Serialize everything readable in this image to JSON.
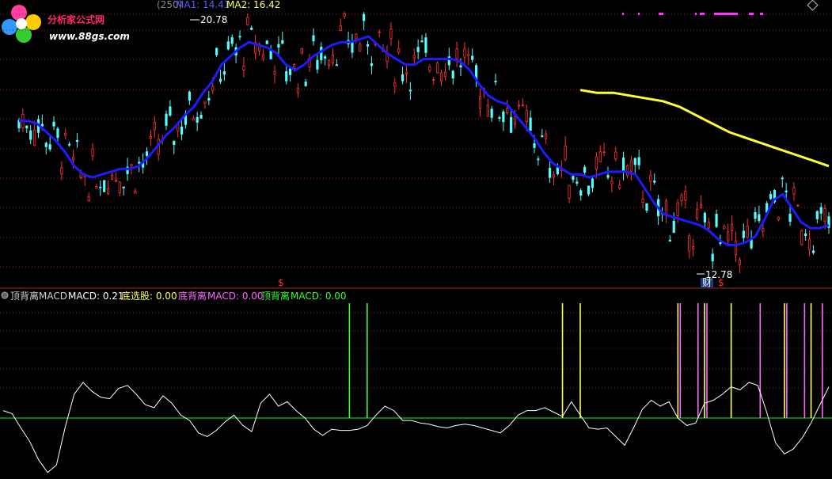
{
  "header": {
    "title_obscured": "(250)",
    "ma1_label": "MA1: 14.41",
    "ma2_label": "MA2: 16.42"
  },
  "watermark": {
    "name": "分析家公式网",
    "url": "www.88gs.com"
  },
  "indicator_header": {
    "title": "顶背离MACD",
    "macd": "MACD: 0.21",
    "bottom_pick": "底选股: 0.00",
    "bottom_div_a": "底背离",
    "bottom_div_b": "MACD: 0.00",
    "top_div_a": "顶背离",
    "top_div_b": "MACD: 0.00"
  },
  "annotations": {
    "high_label": "20.78",
    "low_label": "12.78",
    "marker_s": "$",
    "marker_cai": "财"
  },
  "colors": {
    "background": "#000000",
    "up_candle": "#ff3232",
    "down_candle": "#54ffff",
    "ma1": "#1c1cff",
    "ma2": "#ffff33",
    "macd_line": "#ffffff",
    "zero_line": "#00cc00",
    "top_div_bar": "#33ff33",
    "bottom_pick_bar": "#ffff66",
    "bottom_div_bar": "#ff66ff",
    "grid": "#8a1a1a",
    "separator": "#b02020"
  },
  "chart_data": [
    {
      "type": "candlestick",
      "ylim": [
        12.2,
        21.5
      ],
      "series": [
        {
          "name": "MA1",
          "values": [
            17.6,
            17.6,
            17.5,
            17.2,
            16.9,
            16.5,
            16.0,
            15.7,
            15.6,
            15.7,
            15.8,
            15.9,
            15.9,
            16.0,
            16.3,
            16.7,
            17.1,
            17.4,
            17.8,
            18.1,
            18.6,
            19.0,
            19.6,
            19.9,
            20.2,
            20.4,
            20.3,
            20.2,
            20.0,
            19.6,
            19.4,
            19.6,
            19.9,
            20.1,
            20.3,
            20.4,
            20.4,
            20.5,
            20.6,
            20.3,
            20.0,
            19.8,
            19.6,
            19.6,
            19.8,
            19.8,
            19.8,
            19.8,
            19.7,
            19.4,
            18.9,
            18.5,
            18.3,
            18.2,
            17.8,
            17.4,
            17.0,
            16.5,
            16.1,
            15.9,
            15.7,
            15.7,
            15.6,
            15.7,
            15.8,
            15.8,
            15.8,
            15.7,
            15.2,
            14.7,
            14.3,
            14.2,
            14.1,
            14.0,
            13.9,
            13.7,
            13.4,
            13.2,
            13.2,
            13.3,
            13.5,
            14.1,
            14.8,
            15.0,
            14.5,
            14.0,
            13.8,
            13.8,
            13.9
          ]
        },
        {
          "name": "MA2",
          "values": [
            18.7,
            18.6,
            18.6,
            18.5,
            18.4,
            18.3,
            18.1,
            17.8,
            17.5,
            17.2,
            17.0,
            16.8,
            16.6,
            16.4,
            16.2,
            16.0
          ]
        }
      ],
      "ma2_start_index": 61,
      "high": 20.78,
      "low": 12.78
    },
    {
      "type": "line",
      "series": [
        {
          "name": "MACD",
          "values": [
            0.05,
            0.03,
            -0.08,
            -0.19,
            -0.34,
            -0.44,
            -0.38,
            -0.07,
            0.16,
            0.24,
            0.18,
            0.14,
            0.13,
            0.2,
            0.22,
            0.16,
            0.09,
            0.07,
            0.15,
            0.1,
            0.02,
            -0.02,
            -0.12,
            -0.15,
            -0.1,
            -0.03,
            0.02,
            -0.06,
            -0.11,
            0.1,
            0.16,
            0.08,
            0.11,
            0.05,
            0.0,
            -0.09,
            -0.14,
            -0.09,
            -0.1,
            -0.1,
            -0.09,
            -0.06,
            0.02,
            0.08,
            0.05,
            -0.02,
            -0.02,
            -0.04,
            -0.05,
            -0.07,
            -0.08,
            -0.06,
            -0.05,
            -0.06,
            -0.08,
            -0.1,
            -0.12,
            -0.06,
            0.02,
            0.05,
            0.05,
            0.07,
            0.04,
            0.01,
            0.11,
            0.02,
            -0.08,
            -0.09,
            -0.08,
            -0.15,
            -0.22,
            -0.08,
            0.06,
            0.12,
            0.08,
            0.11,
            0.0,
            -0.06,
            -0.04,
            0.1,
            0.12,
            0.16,
            0.21,
            0.19,
            0.24,
            0.22,
            0.04,
            -0.2,
            -0.29,
            -0.25,
            -0.16,
            -0.04,
            0.09,
            0.21
          ]
        }
      ],
      "zero": 0,
      "markers": {
        "top_div": [
          39,
          41
        ],
        "bottom_pick": [
          63,
          65,
          76,
          79,
          82,
          88,
          91
        ],
        "bottom_div": [
          76,
          78,
          79,
          85,
          88,
          90,
          92
        ]
      }
    }
  ]
}
